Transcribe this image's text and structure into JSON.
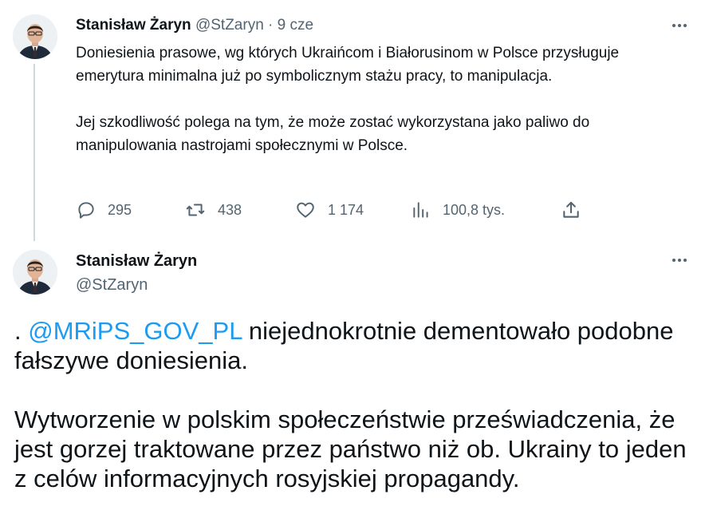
{
  "colors": {
    "text": "#0f1419",
    "secondary": "#536471",
    "accent": "#1d9bf0",
    "thread_line": "#cfd9de"
  },
  "tweet1": {
    "author_name": "Stanisław Żaryn",
    "author_handle": "@StZaryn",
    "separator": "·",
    "time": "9 cze",
    "paragraph1": "Doniesienia prasowe, wg których Ukraińcom i Białorusinom w Polsce przysługuje emerytura minimalna już po symbolicznym stażu pracy, to manipulacja.",
    "paragraph2": "Jej szkodliwość polega na tym, że może zostać wykorzystana jako paliwo do manipulowania nastrojami społecznymi w Polsce.",
    "actions": {
      "replies": {
        "icon": "reply-icon",
        "count": "295"
      },
      "retweets": {
        "icon": "retweet-icon",
        "count": "438"
      },
      "likes": {
        "icon": "heart-icon",
        "count": "1 174"
      },
      "views": {
        "icon": "views-chart-icon",
        "count": "100,8 tys."
      },
      "share": {
        "icon": "share-icon"
      }
    }
  },
  "tweet2": {
    "author_name": "Stanisław Żaryn",
    "author_handle": "@StZaryn",
    "paragraph1_prefix": ". ",
    "mention": "@MRiPS_GOV_PL",
    "paragraph1_suffix": " niejednokrotnie dementowało podobne fałszywe doniesienia.",
    "paragraph2": "Wytworzenie w polskim społeczeństwie przeświadczenia, że jest gorzej traktowane przez państwo niż ob. Ukrainy to jeden z celów informacyjnych rosyjskiej propagandy."
  }
}
